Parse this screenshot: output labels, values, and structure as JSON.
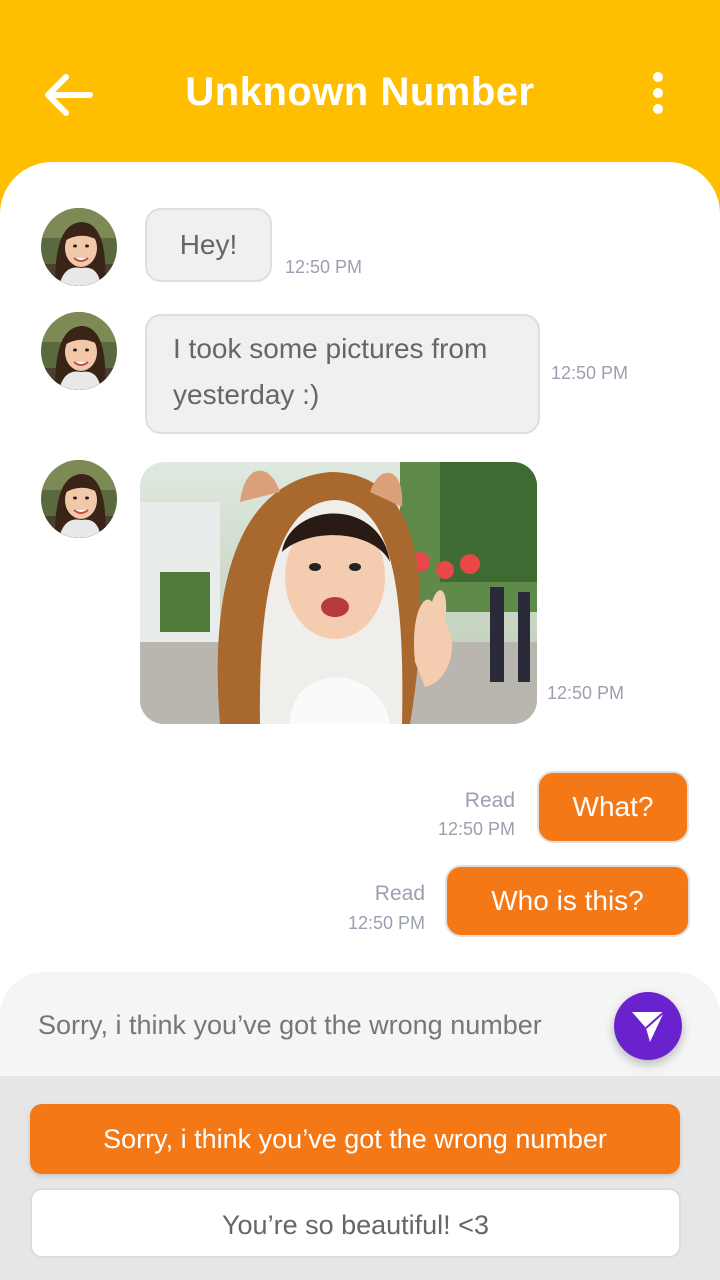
{
  "header": {
    "title": "Unknown Number",
    "back_icon": "arrow-left-icon",
    "menu_icon": "more-vertical-icon"
  },
  "messages": {
    "m1": {
      "text": "Hey!",
      "time": "12:50 PM"
    },
    "m2": {
      "line1": "I took some pictures from",
      "line2": "yesterday :)",
      "time": "12:50 PM"
    },
    "m3": {
      "type": "photo",
      "time": "12:50 PM"
    },
    "m4": {
      "text": "What?",
      "status": "Read",
      "time": "12:50 PM"
    },
    "m5": {
      "text": "Who is this?",
      "status": "Read",
      "time": "12:50 PM"
    }
  },
  "composer": {
    "text": "Sorry, i think you’ve got the wrong number",
    "send_icon": "send-icon"
  },
  "quick_replies": [
    "Sorry, i think you’ve got the wrong number",
    "You’re so beautiful! <3"
  ],
  "colors": {
    "header": "#ffbf00",
    "outgoing": "#f47816",
    "send": "#6a22cf"
  }
}
